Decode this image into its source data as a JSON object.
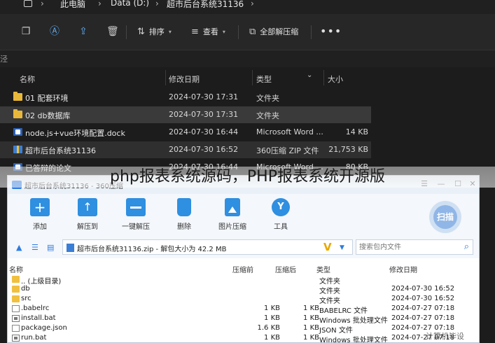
{
  "explorer": {
    "breadcrumb": [
      "此电脑",
      "Data (D:)",
      "超市后台系统31136"
    ],
    "toolbar": {
      "sort_label": "排序",
      "view_label": "查看",
      "extract_all_label": "全部解压缩",
      "more_label": "•••"
    },
    "address_fragment": "泾",
    "columns": {
      "name": "名称",
      "modified": "修改日期",
      "type": "类型",
      "size": "大小"
    },
    "files": [
      {
        "icon": "folder-icon",
        "name": "01 配套环境",
        "modified": "2024-07-30 17:31",
        "type": "文件夹",
        "size": "",
        "state": "normal"
      },
      {
        "icon": "folder-icon",
        "name": "02 db数据库",
        "modified": "2024-07-30 17:31",
        "type": "文件夹",
        "size": "",
        "state": "selected"
      },
      {
        "icon": "word-doc-icon",
        "name": "node.js+vue环境配置.dock",
        "modified": "2024-07-30 16:44",
        "type": "Microsoft Word ...",
        "size": "14 KB",
        "state": "normal"
      },
      {
        "icon": "zip-archive-icon",
        "name": "超市后台系统31136",
        "modified": "2024-07-30 16:52",
        "type": "360压缩 ZIP 文件",
        "size": "21,753 KB",
        "state": "hover"
      },
      {
        "icon": "word-doc-icon",
        "name": "已答辩的论文",
        "modified": "2024-07-30 16:44",
        "type": "Microsoft Word ...",
        "size": "80 KB",
        "state": "normal"
      }
    ]
  },
  "overlay_title": "php报表系统源码，PHP报表系统开源版",
  "zip_window": {
    "title": "超市后台系统31136 - 360压缩",
    "window_controls": [
      "☰",
      "—",
      "☐",
      "✕"
    ],
    "ribbon": [
      {
        "label": "添加",
        "icon": "add-icon"
      },
      {
        "label": "解压到",
        "icon": "extract-to-icon"
      },
      {
        "label": "一键解压",
        "icon": "one-click-extract-icon"
      },
      {
        "label": "删除",
        "icon": "trash-icon"
      },
      {
        "label": "图片压缩",
        "icon": "image-compress-icon"
      },
      {
        "label": "工具",
        "icon": "tools-icon"
      }
    ],
    "scan_label": "扫描",
    "path_text": "超市后台系统31136.zip - 解包大小为 42.2 MB",
    "search_placeholder": "搜索包内文件",
    "columns": {
      "name": "名称",
      "compressed": "压缩前",
      "original": "压缩后",
      "type": "类型",
      "modified": "修改日期"
    },
    "files": [
      {
        "icon": "folder-icon",
        "name": ".. (上级目录)",
        "compressed": "",
        "original": "",
        "type": "文件夹",
        "modified": ""
      },
      {
        "icon": "folder-icon",
        "name": "db",
        "compressed": "",
        "original": "",
        "type": "文件夹",
        "modified": "2024-07-30 16:52"
      },
      {
        "icon": "folder-icon",
        "name": "src",
        "compressed": "",
        "original": "",
        "type": "文件夹",
        "modified": "2024-07-30 16:52"
      },
      {
        "icon": "file-icon",
        "name": ".babelrc",
        "compressed": "1 KB",
        "original": "1 KB",
        "type": "BABELRC 文件",
        "modified": "2024-07-27 07:18"
      },
      {
        "icon": "bat-file-icon",
        "name": "install.bat",
        "compressed": "1 KB",
        "original": "1 KB",
        "type": "Windows 批处理文件",
        "modified": "2024-07-27 07:18"
      },
      {
        "icon": "file-icon",
        "name": "package.json",
        "compressed": "1.6 KB",
        "original": "1 KB",
        "type": "JSON 文件",
        "modified": "2024-07-27 07:18"
      },
      {
        "icon": "bat-file-icon",
        "name": "run.bat",
        "compressed": "1 KB",
        "original": "1 KB",
        "type": "Windows 批处理文件",
        "modified": "2024-07-27 07:18"
      }
    ]
  },
  "corner_watermark": "计算机毕设"
}
